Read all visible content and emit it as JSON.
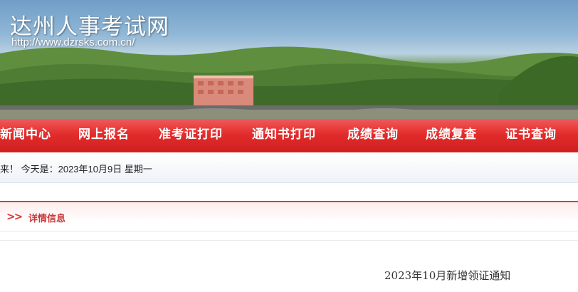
{
  "header": {
    "site_title": "达州人事考试网",
    "site_url": "http://www.dzrsks.com.cn/"
  },
  "nav": {
    "items": [
      {
        "label": "新闻中心"
      },
      {
        "label": "网上报名"
      },
      {
        "label": "准考证打印"
      },
      {
        "label": "通知书打印"
      },
      {
        "label": "成绩查询"
      },
      {
        "label": "成绩复查"
      },
      {
        "label": "证书查询"
      }
    ]
  },
  "datebar": {
    "text": "来！  今天是：2023年10月9日 星期一"
  },
  "section": {
    "chevron": ">>",
    "label": "详情信息"
  },
  "article": {
    "title": "2023年10月新增领证通知"
  },
  "colors": {
    "nav_red": "#e32c2c",
    "section_accent": "#d83a3a"
  }
}
